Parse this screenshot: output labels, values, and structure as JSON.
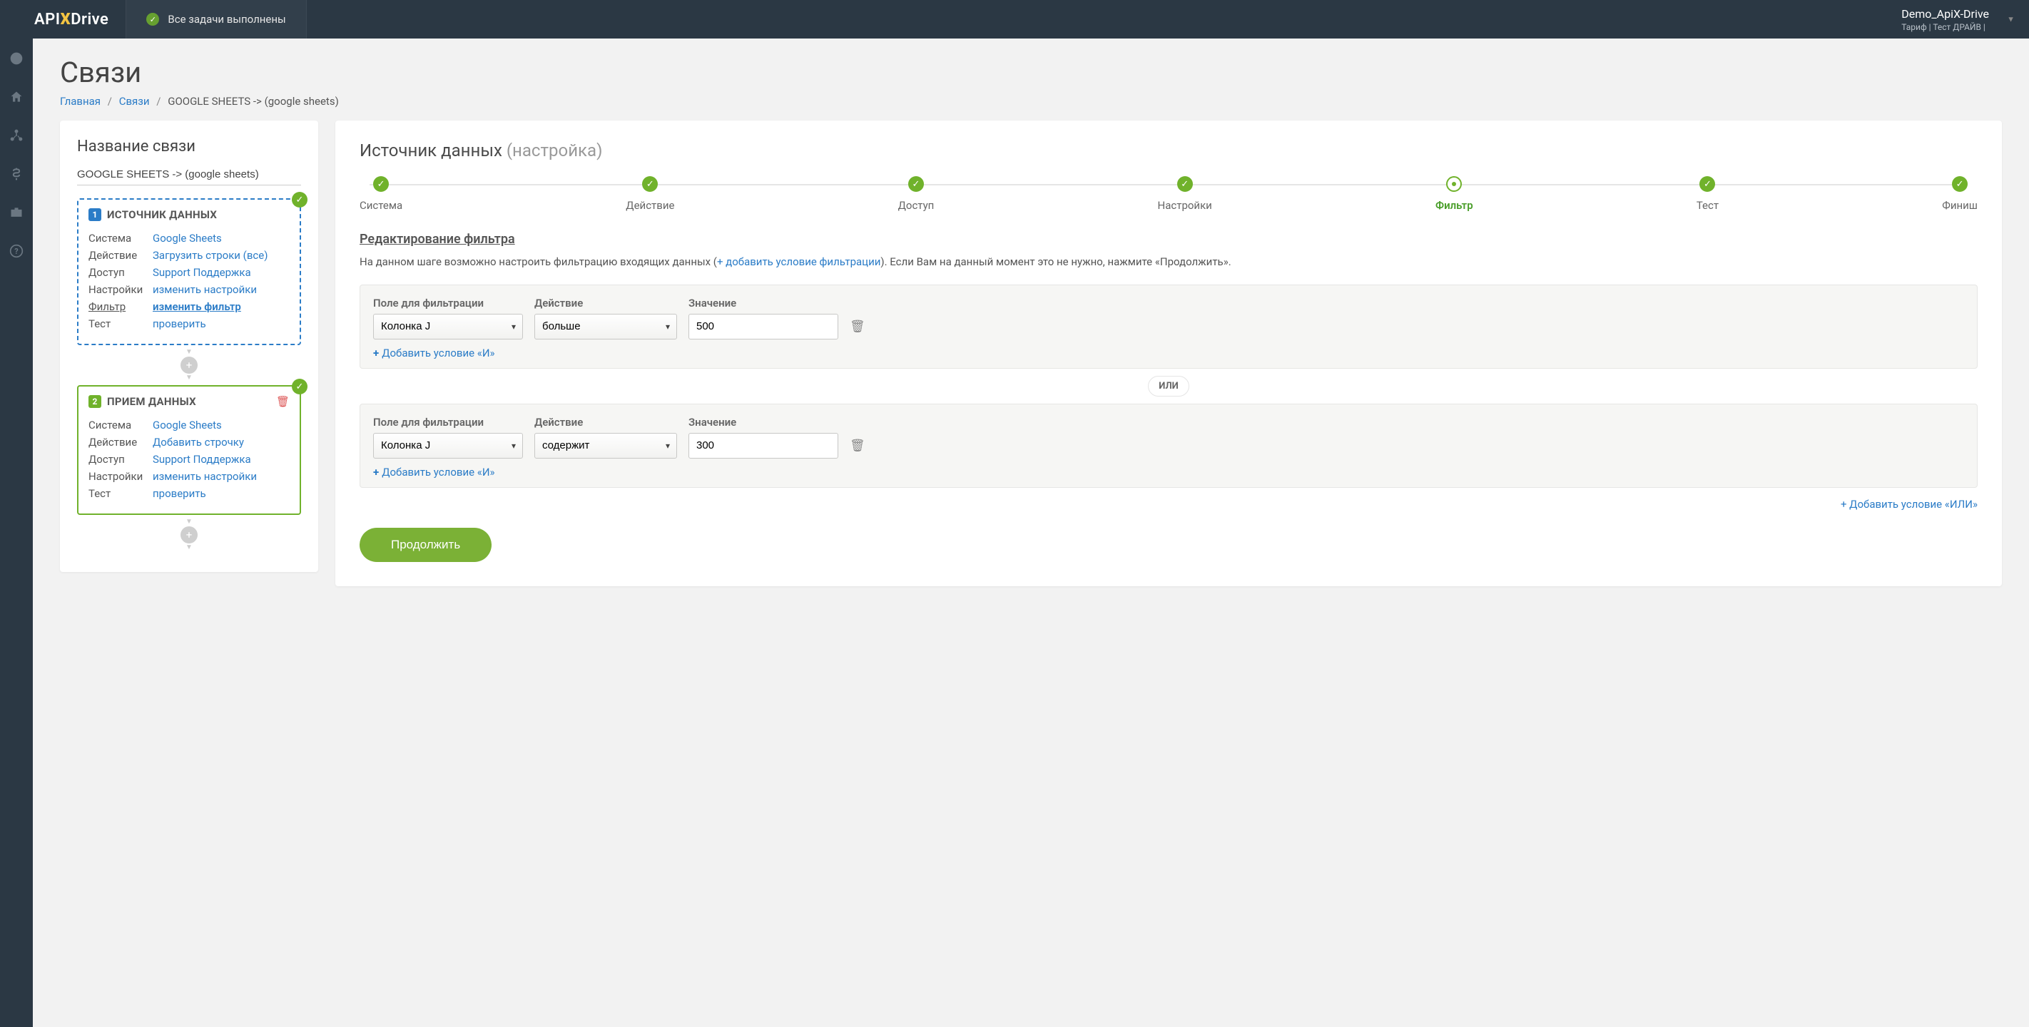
{
  "topbar": {
    "logo_prefix": "API",
    "logo_x": "X",
    "logo_suffix": "Drive",
    "tasks_done": "Все задачи выполнены",
    "account_name": "Demo_ApiX-Drive",
    "account_plan": "Тариф | Тест ДРАЙВ |"
  },
  "page": {
    "title": "Связи"
  },
  "breadcrumb": {
    "home": "Главная",
    "links": "Связи",
    "current": "GOOGLE SHEETS -> (google sheets)"
  },
  "left": {
    "title": "Название связи",
    "conn_name": "GOOGLE SHEETS -> (google sheets)",
    "src": {
      "num": "1",
      "title": "ИСТОЧНИК ДАННЫХ",
      "rows": [
        {
          "k": "Система",
          "v": "Google Sheets"
        },
        {
          "k": "Действие",
          "v": "Загрузить строки (все)"
        },
        {
          "k": "Доступ",
          "v": "Support Поддержка"
        },
        {
          "k": "Настройки",
          "v": "изменить настройки"
        },
        {
          "k": "Фильтр",
          "v": "изменить фильтр",
          "active": true
        },
        {
          "k": "Тест",
          "v": "проверить"
        }
      ]
    },
    "dst": {
      "num": "2",
      "title": "ПРИЕМ ДАННЫХ",
      "rows": [
        {
          "k": "Система",
          "v": "Google Sheets"
        },
        {
          "k": "Действие",
          "v": "Добавить строчку"
        },
        {
          "k": "Доступ",
          "v": "Support Поддержка"
        },
        {
          "k": "Настройки",
          "v": "изменить настройки"
        },
        {
          "k": "Тест",
          "v": "проверить"
        }
      ]
    }
  },
  "right": {
    "title_main": "Источник данных",
    "title_sub": "(настройка)",
    "steps": [
      "Система",
      "Действие",
      "Доступ",
      "Настройки",
      "Фильтр",
      "Тест",
      "Финиш"
    ],
    "current_step": 4,
    "section_title": "Редактирование фильтра",
    "help_pre": "На данном шаге возможно настроить фильтрацию входящих данных (",
    "help_link": "+ добавить условие фильтрации",
    "help_post": "). Если Вам на данный момент это не нужно, нажмите «Продолжить».",
    "labels": {
      "field": "Поле для фильтрации",
      "action": "Действие",
      "value": "Значение",
      "add_and": "Добавить условие «И»",
      "or": "ИЛИ",
      "add_or": "+ Добавить условие «ИЛИ»",
      "continue": "Продолжить"
    },
    "filters": [
      {
        "field": "Колонка J",
        "action": "больше",
        "value": "500"
      },
      {
        "field": "Колонка J",
        "action": "содержит",
        "value": "300"
      }
    ]
  }
}
